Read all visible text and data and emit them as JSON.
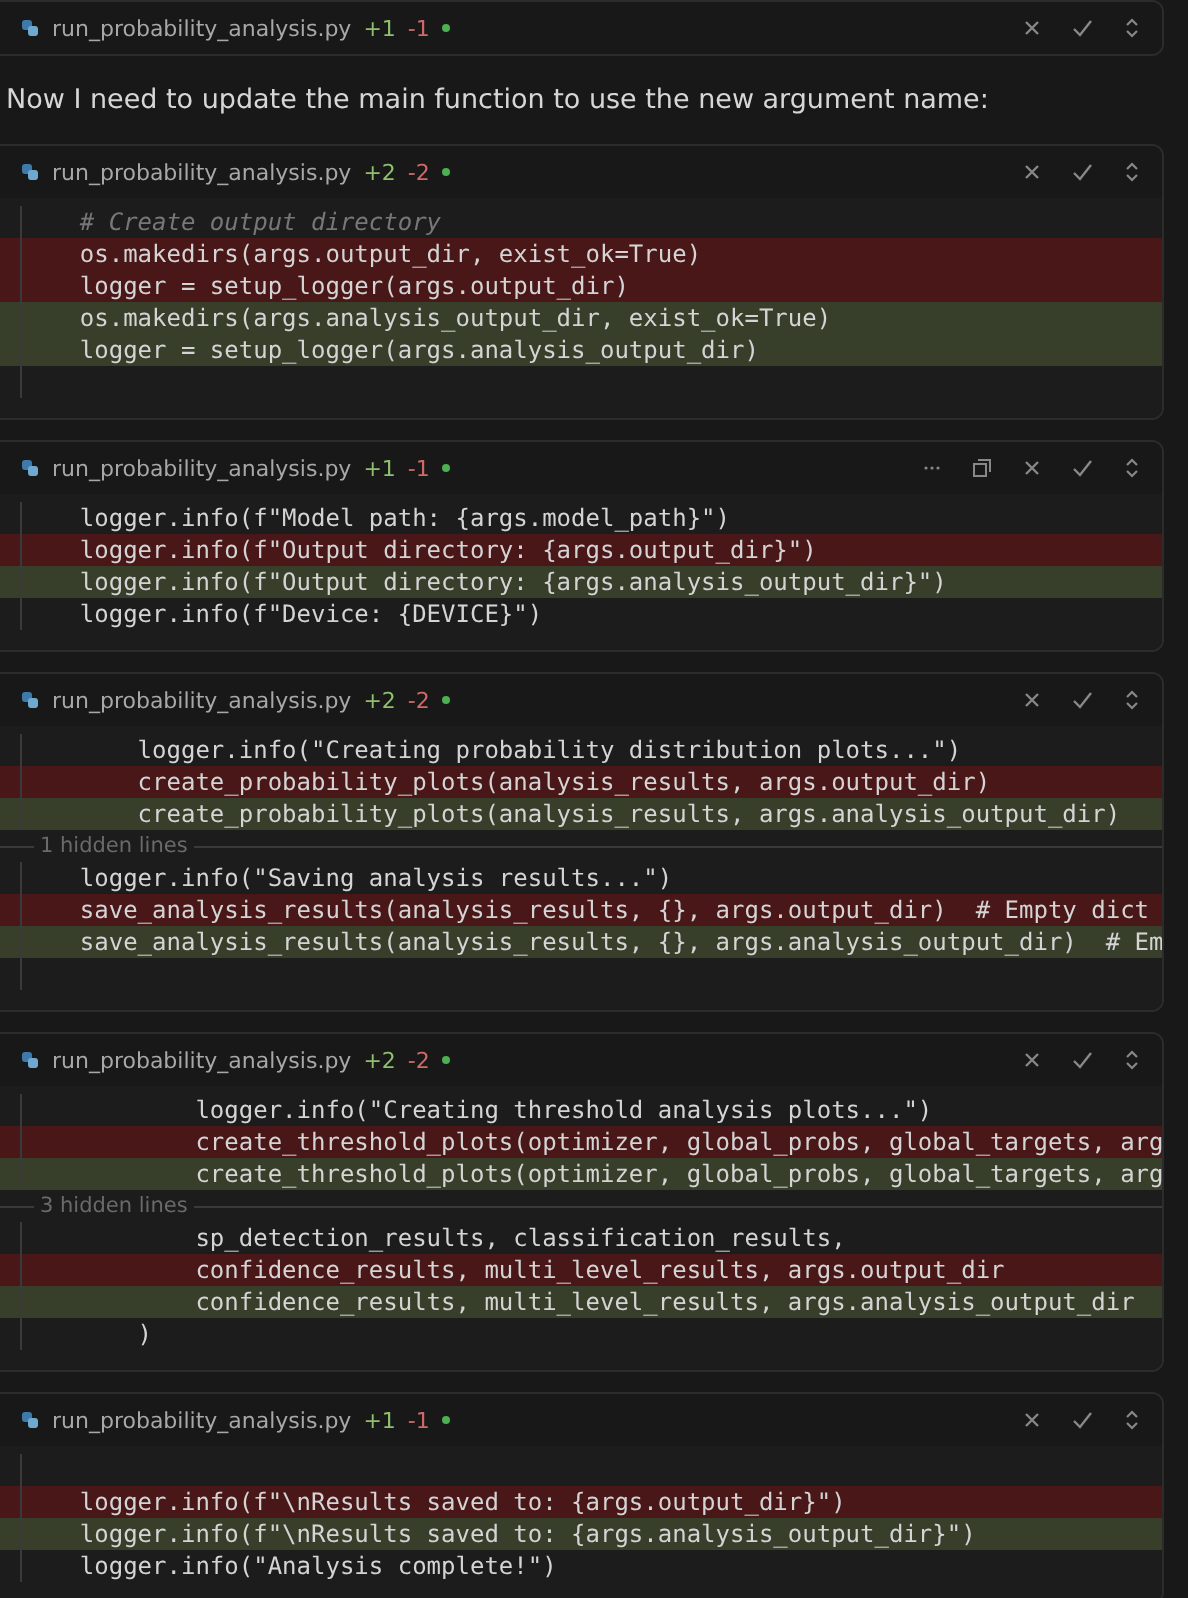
{
  "items": [
    {
      "kind": "card",
      "file": "run_probability_analysis.py",
      "added": "+1",
      "removed": "-1",
      "extra_actions": false
    },
    {
      "kind": "message",
      "text": "Now I need to update the main function to use the new argument name:"
    },
    {
      "kind": "card",
      "file": "run_probability_analysis.py",
      "added": "+2",
      "removed": "-2",
      "extra_actions": false,
      "lines": [
        {
          "kind": "comment",
          "text": "    # Create output directory"
        },
        {
          "kind": "removed",
          "text": "    os.makedirs(args.output_dir, exist_ok=True)"
        },
        {
          "kind": "removed",
          "text": "    logger = setup_logger(args.output_dir)"
        },
        {
          "kind": "added",
          "text": "    os.makedirs(args.analysis_output_dir, exist_ok=True)"
        },
        {
          "kind": "added",
          "text": "    logger = setup_logger(args.analysis_output_dir)"
        },
        {
          "kind": "blank"
        }
      ]
    },
    {
      "kind": "card",
      "file": "run_probability_analysis.py",
      "added": "+1",
      "removed": "-1",
      "extra_actions": true,
      "lines": [
        {
          "kind": "context",
          "text": "    logger.info(f\"Model path: {args.model_path}\")"
        },
        {
          "kind": "removed",
          "text": "    logger.info(f\"Output directory: {args.output_dir}\")"
        },
        {
          "kind": "added",
          "text": "    logger.info(f\"Output directory: {args.analysis_output_dir}\")"
        },
        {
          "kind": "context",
          "text": "    logger.info(f\"Device: {DEVICE}\")"
        }
      ]
    },
    {
      "kind": "card",
      "file": "run_probability_analysis.py",
      "added": "+2",
      "removed": "-2",
      "extra_actions": false,
      "lines": [
        {
          "kind": "context",
          "text": "        logger.info(\"Creating probability distribution plots...\")"
        },
        {
          "kind": "removed",
          "text": "        create_probability_plots(analysis_results, args.output_dir)"
        },
        {
          "kind": "added",
          "text": "        create_probability_plots(analysis_results, args.analysis_output_dir)"
        },
        {
          "kind": "hidden",
          "text": "1 hidden lines"
        },
        {
          "kind": "context",
          "text": "    logger.info(\"Saving analysis results...\")"
        },
        {
          "kind": "removed",
          "text": "    save_analysis_results(analysis_results, {}, args.output_dir)  # Empty dict"
        },
        {
          "kind": "added",
          "text": "    save_analysis_results(analysis_results, {}, args.analysis_output_dir)  # Em"
        },
        {
          "kind": "blank"
        }
      ]
    },
    {
      "kind": "card",
      "file": "run_probability_analysis.py",
      "added": "+2",
      "removed": "-2",
      "extra_actions": false,
      "lines": [
        {
          "kind": "context",
          "text": "            logger.info(\"Creating threshold analysis plots...\")"
        },
        {
          "kind": "removed",
          "text": "            create_threshold_plots(optimizer, global_probs, global_targets, arg"
        },
        {
          "kind": "added",
          "text": "            create_threshold_plots(optimizer, global_probs, global_targets, arg"
        },
        {
          "kind": "hidden",
          "text": "3 hidden lines"
        },
        {
          "kind": "context",
          "text": "            sp_detection_results, classification_results,"
        },
        {
          "kind": "removed",
          "text": "            confidence_results, multi_level_results, args.output_dir"
        },
        {
          "kind": "added",
          "text": "            confidence_results, multi_level_results, args.analysis_output_dir"
        },
        {
          "kind": "context",
          "text": "        )"
        }
      ]
    },
    {
      "kind": "card",
      "file": "run_probability_analysis.py",
      "added": "+1",
      "removed": "-1",
      "extra_actions": false,
      "lines": [
        {
          "kind": "blank"
        },
        {
          "kind": "removed",
          "text": "    logger.info(f\"\\nResults saved to: {args.output_dir}\")"
        },
        {
          "kind": "added",
          "text": "    logger.info(f\"\\nResults saved to: {args.analysis_output_dir}\")"
        },
        {
          "kind": "context",
          "text": "    logger.info(\"Analysis complete!\")"
        }
      ]
    }
  ]
}
